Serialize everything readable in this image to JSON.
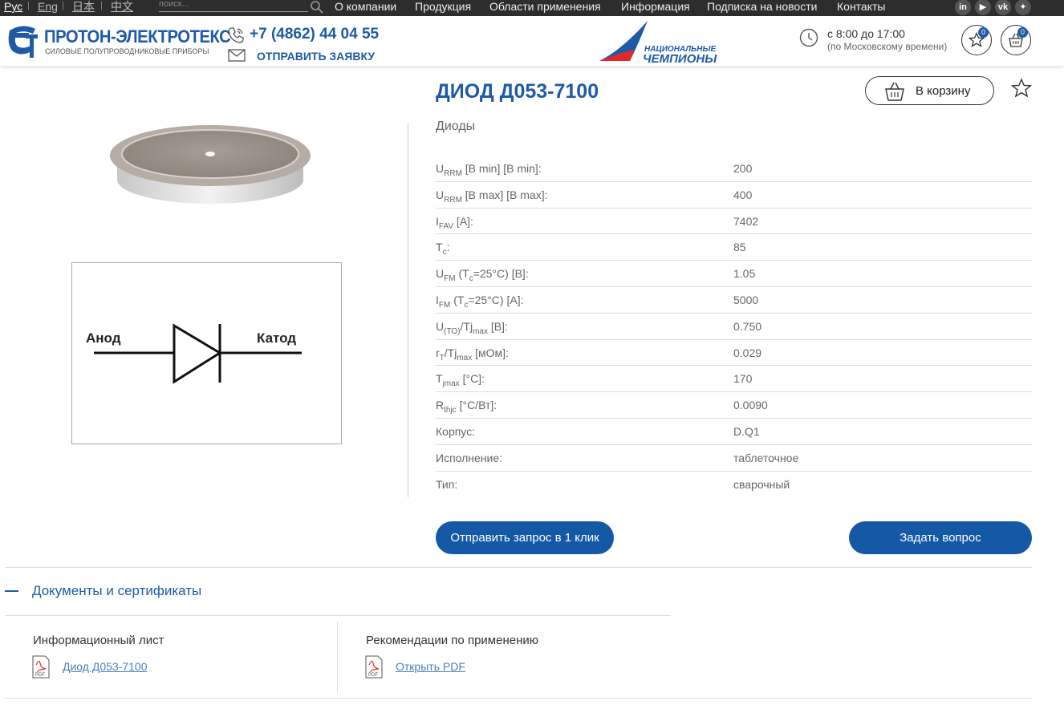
{
  "topbar": {
    "languages": [
      "Рус",
      "Eng",
      "日本",
      "中文"
    ],
    "search_placeholder": "поиск...",
    "nav": [
      "О компании",
      "Продукция",
      "Области применения",
      "Информация",
      "Подписка на новости",
      "Контакты"
    ],
    "social": [
      "in",
      "yt",
      "vk",
      "z"
    ]
  },
  "header": {
    "logo_name": "ПРОТОН-ЭЛЕКТРОТЕКС",
    "logo_sub": "СИЛОВЫЕ ПОЛУПРОВОДНИКОВЫЕ ПРИБОРЫ",
    "phone": "+7 (4862) 44 04 55",
    "request": "ОТПРАВИТЬ ЗАЯВКУ",
    "champ_line1": "НАЦИОНАЛЬНЫЕ",
    "champ_line2": "ЧЕМПИОНЫ",
    "hours": "с 8:00 до 17:00",
    "hours_note": "(по Московскому времени)",
    "favorites_count": "0",
    "cart_count": "0"
  },
  "product": {
    "title": "ДИОД Д053-7100",
    "category": "Диоды",
    "cart_button": "В корзину",
    "schematic_anode": "Анод",
    "schematic_cathode": "Катод",
    "specs": [
      {
        "value": "200"
      },
      {
        "value": "400"
      },
      {
        "value": "7402"
      },
      {
        "value": "85"
      },
      {
        "value": "1.05"
      },
      {
        "value": "5000"
      },
      {
        "value": "0.750"
      },
      {
        "value": "0.029"
      },
      {
        "value": "170"
      },
      {
        "value": "0.0090"
      },
      {
        "name": "Корпус:",
        "value": "D.Q1"
      },
      {
        "name": "Исполнение:",
        "value": "таблеточное"
      },
      {
        "name": "Тип:",
        "value": "сварочный"
      }
    ],
    "btn_quick": "Отправить запрос в 1 клик",
    "btn_ask": "Задать вопрос"
  },
  "docs": {
    "title": "Документы и сертификаты",
    "items": [
      {
        "heading": "Информационный лист",
        "link": "Диод Д053-7100"
      },
      {
        "heading": "Рекомендации по применению",
        "link": "Открыть PDF"
      }
    ]
  },
  "colors": {
    "brand": "#1f5aa6",
    "button": "#1558a6",
    "topbar": "#2d2d2d"
  }
}
